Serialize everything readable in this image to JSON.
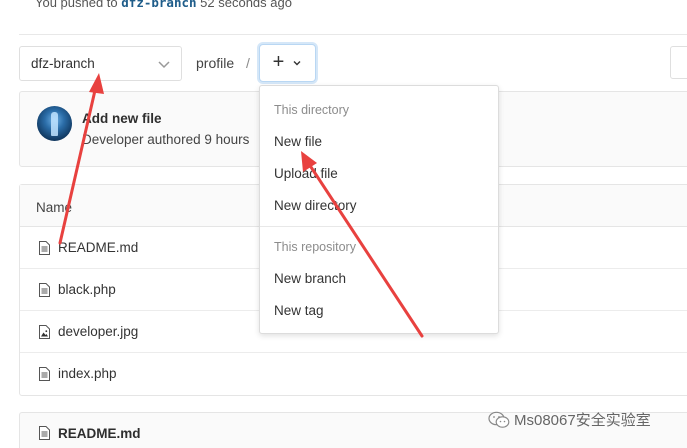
{
  "push_notice": {
    "prefix": "You pushed to",
    "branch": "dfz-branch",
    "suffix": "52 seconds ago"
  },
  "branch_selector": {
    "value": "dfz-branch",
    "caret_icon": "chevron-down-icon"
  },
  "breadcrumb": {
    "project": "profile",
    "separator": "/"
  },
  "add_button": {
    "label": "+",
    "caret_icon": "chevron-down-icon"
  },
  "last_commit": {
    "title": "Add new file",
    "meta": "Developer authored 9 hours"
  },
  "file_tree": {
    "header": "Name",
    "files": [
      {
        "name": "README.md",
        "icon": "file-text-icon"
      },
      {
        "name": "black.php",
        "icon": "file-text-icon"
      },
      {
        "name": "developer.jpg",
        "icon": "file-image-icon"
      },
      {
        "name": "index.php",
        "icon": "file-text-icon"
      }
    ]
  },
  "readme_panel": {
    "title": "README.md",
    "icon": "file-text-icon"
  },
  "dropdown": {
    "directory_header": "This directory",
    "new_file": "New file",
    "upload_file": "Upload file",
    "new_directory": "New directory",
    "repository_header": "This repository",
    "new_branch": "New branch",
    "new_tag": "New tag"
  },
  "watermark": {
    "text": "Ms08067安全实验室",
    "icon": "wechat-icon"
  },
  "colors": {
    "annotation_arrow": "#e8413f",
    "link_blue": "#1f5d8a",
    "focus_ring": "#b9d7f3"
  }
}
